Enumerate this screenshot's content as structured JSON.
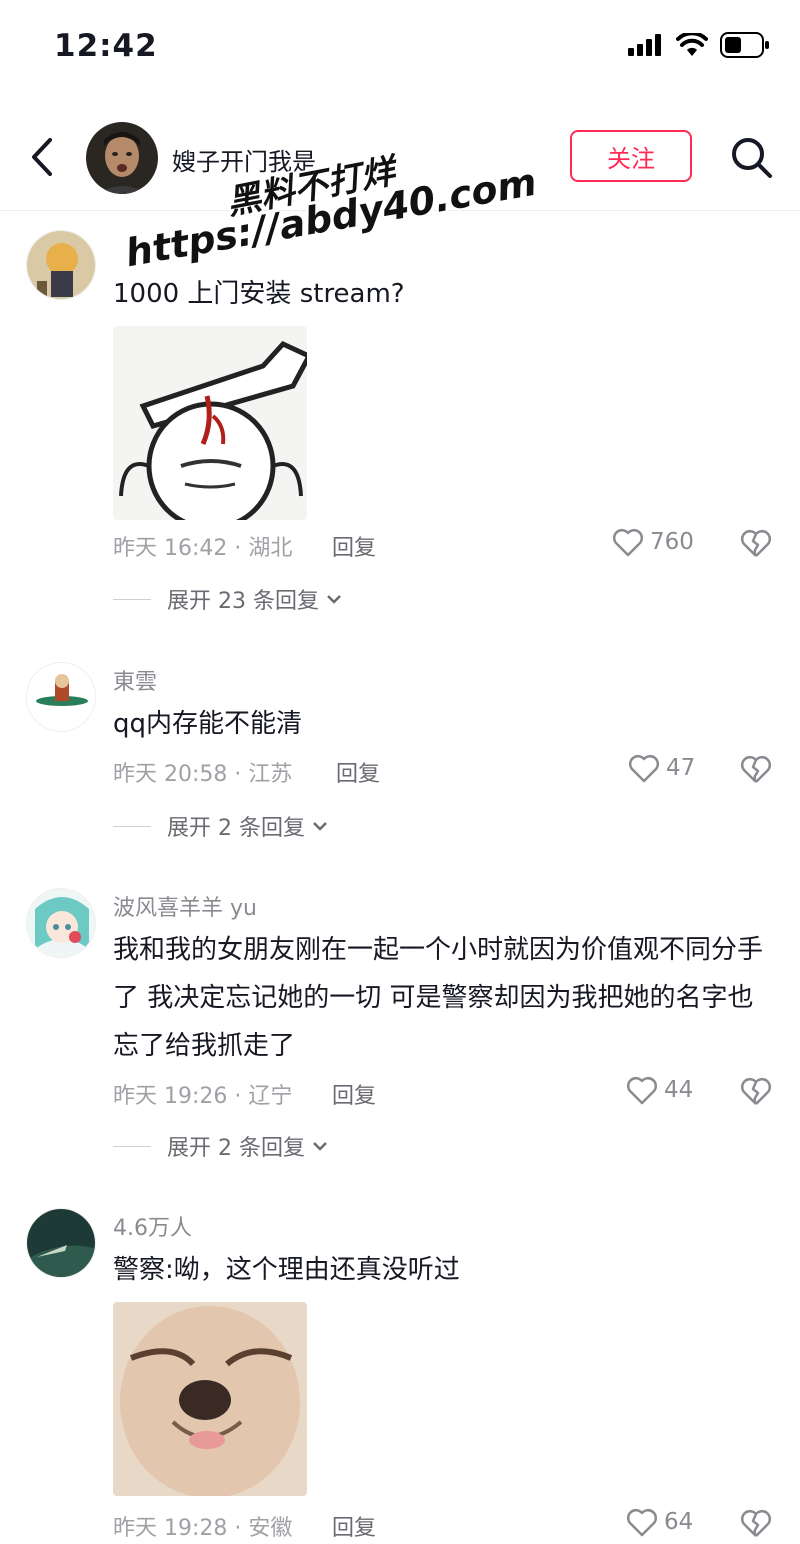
{
  "status_bar": {
    "time": "12:42"
  },
  "header": {
    "title": "嫂子开门我是",
    "follow_label": "关注"
  },
  "watermark": {
    "line1": "黑料不打烊",
    "line2": "https://abdy40.com"
  },
  "comments": [
    {
      "username": "",
      "text": "1000 上门安装 stream?",
      "meta": "昨天 16:42 · 湖北",
      "reply_label": "回复",
      "likes": "760",
      "expand_label": "展开 23 条回复"
    },
    {
      "username": "東雲",
      "text": "qq内存能不能清",
      "meta": "昨天 20:58 · 江苏",
      "reply_label": "回复",
      "likes": "47",
      "expand_label": "展开 2 条回复"
    },
    {
      "username": "波风喜羊羊 yu",
      "text": "我和我的女朋友刚在一起一个小时就因为价值观不同分手了 我决定忘记她的一切 可是警察却因为我把她的名字也忘了给我抓走了",
      "meta": "昨天 19:26 · 辽宁",
      "reply_label": "回复",
      "likes": "44",
      "expand_label": "展开 2 条回复"
    },
    {
      "username": "4.6万人",
      "text": "警察:呦，这个理由还真没听过",
      "meta": "昨天 19:28 · 安徽",
      "reply_label": "回复",
      "likes": "64"
    }
  ],
  "colors": {
    "accent": "#fe2c55",
    "text": "#161823",
    "muted": "#a0a1a6"
  }
}
